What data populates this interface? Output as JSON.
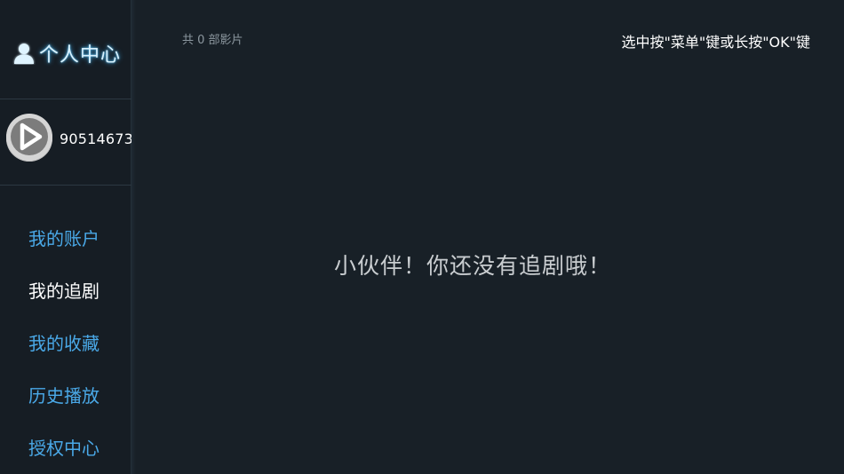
{
  "sidebar": {
    "title": "个人中心",
    "title_icon": "user-icon",
    "user": {
      "avatar_icon": "play-logo-icon",
      "id": "90514673"
    },
    "items": [
      {
        "label": "我的账户",
        "active": false
      },
      {
        "label": "我的追剧",
        "active": true
      },
      {
        "label": "我的收藏",
        "active": false
      },
      {
        "label": "历史播放",
        "active": false
      },
      {
        "label": "授权中心",
        "active": false
      }
    ]
  },
  "main": {
    "count_text": "共 0 部影片",
    "hint": "选中按\"菜单\"键或长按\"OK\"键",
    "empty_message": "小伙伴！你还没有追剧哦！"
  },
  "colors": {
    "background": "#182027",
    "sidebar": "#161d24",
    "accent": "#4aa9e8",
    "active": "#ffffff"
  }
}
